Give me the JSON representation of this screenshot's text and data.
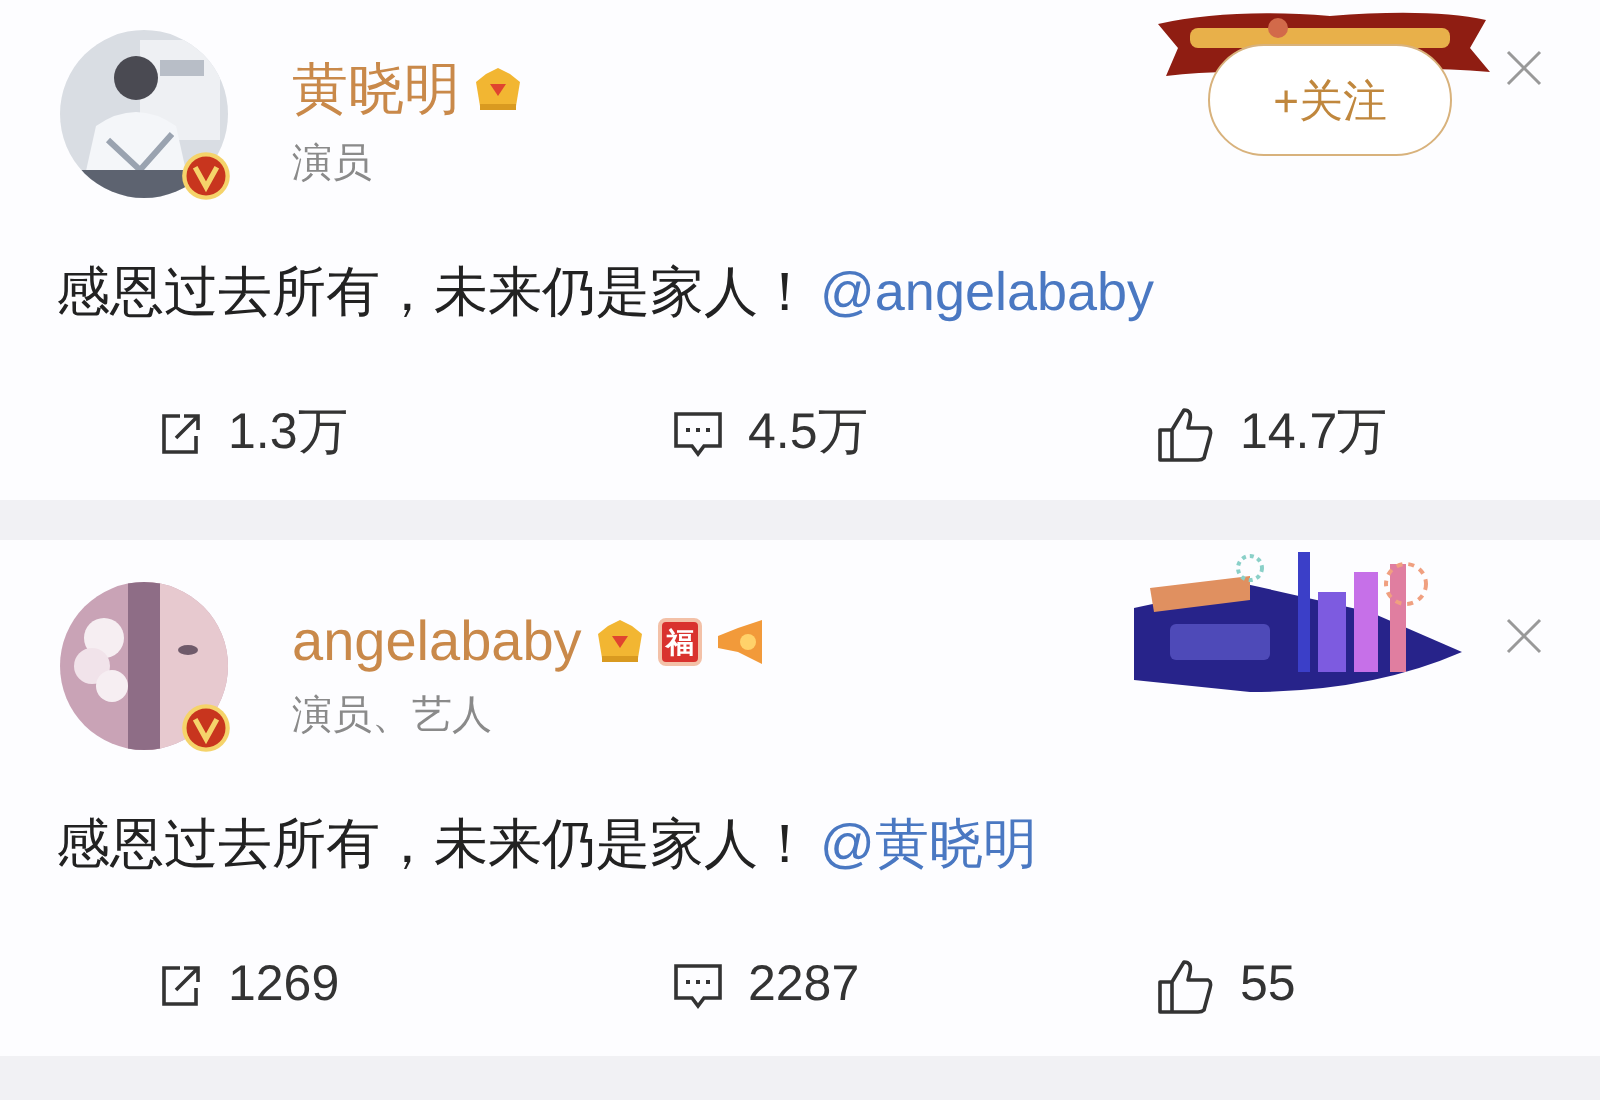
{
  "posts": [
    {
      "author": {
        "name": "黄晓明",
        "title": "演员",
        "verified": true,
        "vip": true
      },
      "badges": [
        {
          "kind": "crown"
        }
      ],
      "follow_button": {
        "label": "+关注"
      },
      "banner": {
        "kind": "picture"
      },
      "content": [
        {
          "kind": "text",
          "text": "感恩过去所有，未来仍是家人！"
        },
        {
          "kind": "mention",
          "text": "@angelababy"
        }
      ],
      "actions": [
        {
          "kind": "repost",
          "count": "1.3万"
        },
        {
          "kind": "comment",
          "count": "4.5万"
        },
        {
          "kind": "like",
          "count": "14.7万"
        }
      ]
    },
    {
      "author": {
        "name": "angelababy",
        "title": "演员、艺人",
        "verified": true,
        "vip": true
      },
      "badges": [
        {
          "kind": "crown"
        },
        {
          "kind": "fu",
          "text": "福"
        },
        {
          "kind": "megaphone"
        }
      ],
      "banner": {
        "kind": "picture"
      },
      "content": [
        {
          "kind": "text",
          "text": "感恩过去所有，未来仍是家人！"
        },
        {
          "kind": "mention",
          "text": "@黄晓明"
        }
      ],
      "actions": [
        {
          "kind": "repost",
          "count": "1269"
        },
        {
          "kind": "comment",
          "count": "2287"
        },
        {
          "kind": "like",
          "count": "55"
        }
      ]
    }
  ]
}
